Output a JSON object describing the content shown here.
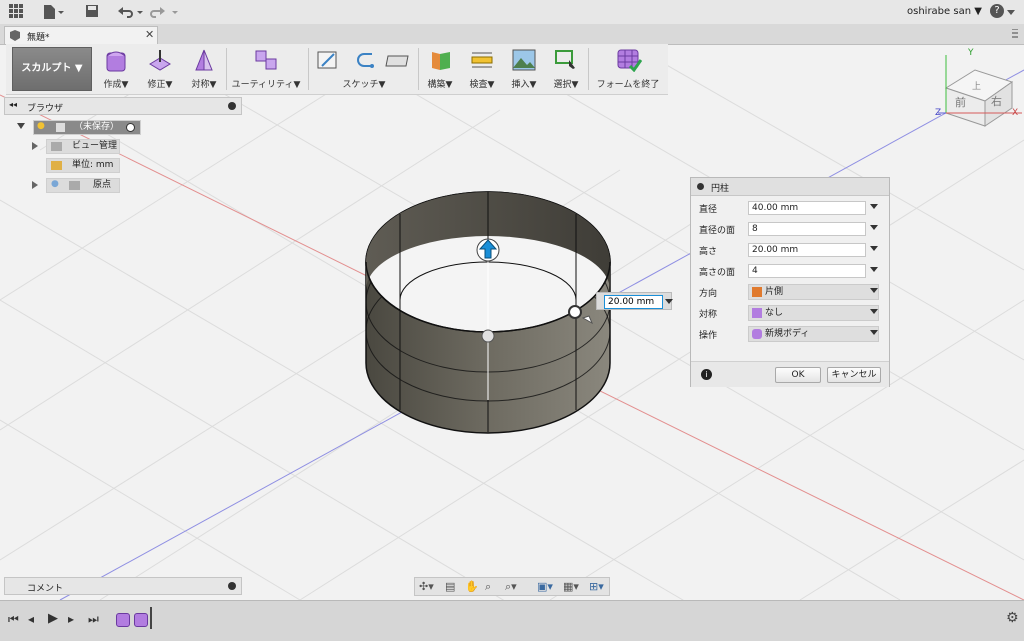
{
  "topbar": {
    "user": "oshirabe san ▼",
    "help": "?"
  },
  "tabs": [
    {
      "label": "無題*"
    }
  ],
  "ribbon": {
    "workspace": "スカルプト ▼",
    "groups": [
      "作成▼",
      "修正▼",
      "対称▼",
      "ユーティリティ▼",
      "スケッチ▼",
      "構築▼",
      "検査▼",
      "挿入▼",
      "選択▼",
      "フォームを終了"
    ]
  },
  "browser": {
    "title": "ブラウザ",
    "root": "（未保存）",
    "items": [
      "ビュー管理",
      "単位: mm",
      "原点"
    ]
  },
  "comment": {
    "title": "コメント"
  },
  "viewcube": {
    "top": "上",
    "front": "前",
    "right": "右",
    "axis_x": "X",
    "axis_y": "Y",
    "axis_z": "Z"
  },
  "canvas": {
    "height_input": "20.00 mm"
  },
  "dialog": {
    "title": "円柱",
    "rows": [
      {
        "label": "直径",
        "value": "40.00 mm"
      },
      {
        "label": "直径の面",
        "value": "8"
      },
      {
        "label": "高さ",
        "value": "20.00 mm"
      },
      {
        "label": "高さの面",
        "value": "4"
      },
      {
        "label": "方向",
        "value": "片側"
      },
      {
        "label": "対称",
        "value": "なし"
      },
      {
        "label": "操作",
        "value": "新規ボディ"
      }
    ],
    "ok": "OK",
    "cancel": "キャンセル",
    "info": "i"
  },
  "colors": {
    "accent": "#1a8fd8",
    "selection": "#9b59d0"
  }
}
